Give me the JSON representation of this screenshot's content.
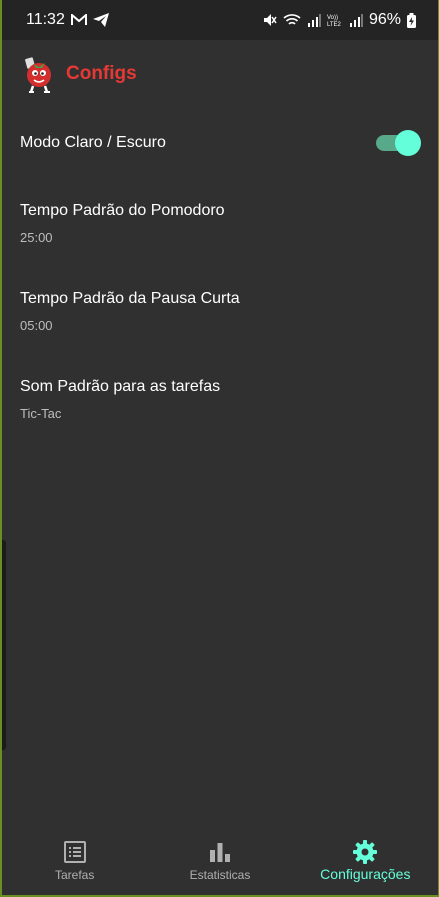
{
  "status_bar": {
    "time": "11:32",
    "battery": "96%",
    "left_icons": [
      "gmail-icon",
      "telegram-icon"
    ],
    "right_icons": [
      "mute-icon",
      "wifi-icon",
      "signal-icon",
      "volte-icon",
      "signal-icon",
      "battery-charging-icon"
    ]
  },
  "app_bar": {
    "title": "Configs",
    "logo": "tomato-mascot-logo"
  },
  "settings": {
    "theme": {
      "label": "Modo Claro / Escuro",
      "enabled": true
    },
    "pomodoro": {
      "label": "Tempo Padrão do Pomodoro",
      "value": "25:00"
    },
    "short_break": {
      "label": "Tempo Padrão da Pausa Curta",
      "value": "05:00"
    },
    "sound": {
      "label": "Som Padrão para as tarefas",
      "value": "Tic-Tac"
    }
  },
  "bottom_nav": {
    "items": [
      {
        "label": "Tarefas",
        "icon": "list-icon",
        "active": false
      },
      {
        "label": "Estatisticas",
        "icon": "bar-chart-icon",
        "active": false
      },
      {
        "label": "Configurações",
        "icon": "gear-icon",
        "active": true
      }
    ]
  },
  "colors": {
    "accent": "#64ffda",
    "title_red": "#e53935",
    "background": "#303030"
  }
}
